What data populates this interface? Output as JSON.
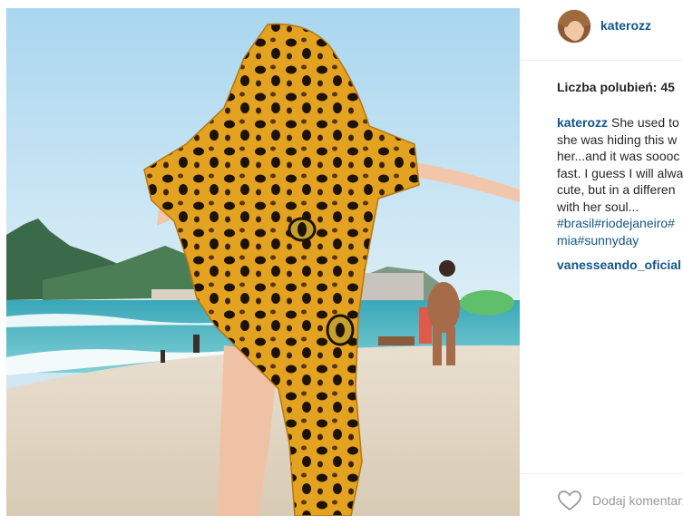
{
  "post": {
    "username": "katerozz",
    "likes_text": "Liczba polubień: 45",
    "photo_icon": "beach-photo"
  },
  "comments": [
    {
      "author": "katerozz",
      "lines": [
        "She used to",
        "she was hiding this w",
        "her...and it was soooc",
        "fast. I guess I will alwa",
        "cute, but in a differen",
        "with her soul..."
      ],
      "hashtags_line1": "#brasil#riodejaneiro#",
      "hashtags_line2": "mia#sunnyday"
    },
    {
      "author": "vanesseando_oficial",
      "lines": []
    }
  ],
  "actions": {
    "like_icon": "heart-icon",
    "add_comment_placeholder": "Dodaj komentarz..."
  },
  "colors": {
    "link": "#125688",
    "text": "#262626",
    "placeholder": "#999999"
  }
}
